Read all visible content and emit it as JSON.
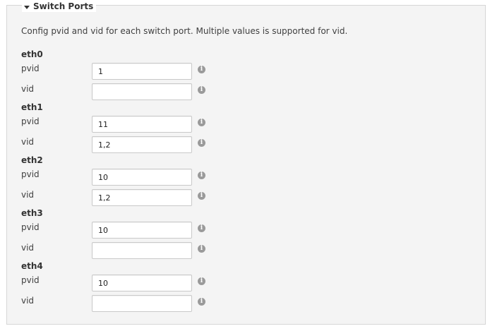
{
  "section": {
    "title": "Switch Ports",
    "description": "Config pvid and vid for each switch port. Multiple values is supported for vid."
  },
  "ports": [
    {
      "name": "eth0",
      "pvid_label": "pvid",
      "pvid": "1",
      "vid_label": "vid",
      "vid": ""
    },
    {
      "name": "eth1",
      "pvid_label": "pvid",
      "pvid": "11",
      "vid_label": "vid",
      "vid": "1,2"
    },
    {
      "name": "eth2",
      "pvid_label": "pvid",
      "pvid": "10",
      "vid_label": "vid",
      "vid": "1,2"
    },
    {
      "name": "eth3",
      "pvid_label": "pvid",
      "pvid": "10",
      "vid_label": "vid",
      "vid": ""
    },
    {
      "name": "eth4",
      "pvid_label": "pvid",
      "pvid": "10",
      "vid_label": "vid",
      "vid": ""
    }
  ],
  "icons": {
    "collapse": "caret-down-icon",
    "help": "info-icon",
    "help_glyph": "i"
  },
  "colors": {
    "panel_background": "#f4f4f4",
    "panel_border": "#d6d6d6",
    "info_icon": "#9a9a9a"
  }
}
